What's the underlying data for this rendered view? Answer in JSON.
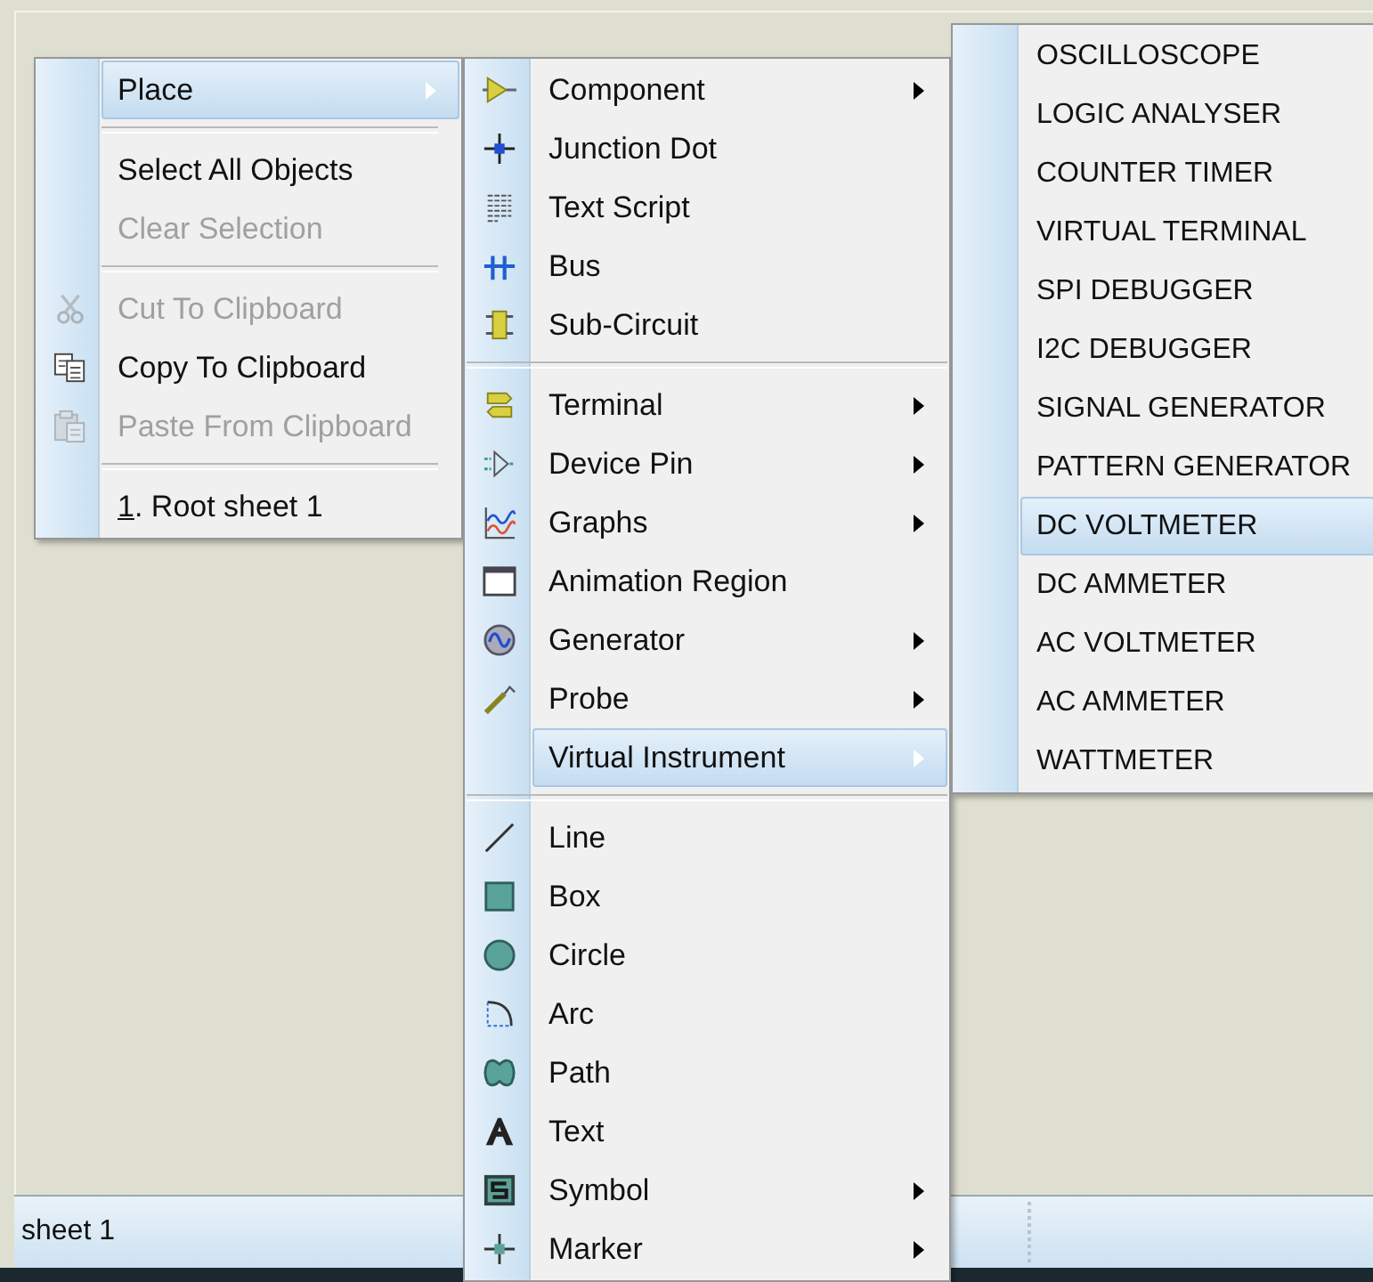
{
  "context_menu": {
    "groups": [
      [
        {
          "label": "Place",
          "disabled": false,
          "selected": true,
          "submenu": true
        }
      ],
      [
        {
          "label": "Select All Objects",
          "disabled": false,
          "selected": false,
          "submenu": false
        },
        {
          "label": "Clear Selection",
          "disabled": true,
          "selected": false,
          "submenu": false
        }
      ],
      [
        {
          "label": "Cut To Clipboard",
          "disabled": true,
          "selected": false,
          "submenu": false
        },
        {
          "label": "Copy To Clipboard",
          "disabled": false,
          "selected": false,
          "submenu": false
        },
        {
          "label": "Paste From Clipboard",
          "disabled": true,
          "selected": false,
          "submenu": false
        }
      ],
      [
        {
          "label": "1. Root sheet 1",
          "disabled": false,
          "selected": false,
          "submenu": false,
          "underline_first": true
        }
      ]
    ]
  },
  "place_menu": {
    "groups": [
      [
        {
          "label": "Component",
          "disabled": false,
          "selected": false,
          "submenu": true
        },
        {
          "label": "Junction Dot",
          "disabled": false,
          "selected": false,
          "submenu": false
        },
        {
          "label": "Text Script",
          "disabled": false,
          "selected": false,
          "submenu": false
        },
        {
          "label": "Bus",
          "disabled": false,
          "selected": false,
          "submenu": false
        },
        {
          "label": "Sub-Circuit",
          "disabled": false,
          "selected": false,
          "submenu": false
        }
      ],
      [
        {
          "label": "Terminal",
          "disabled": false,
          "selected": false,
          "submenu": true
        },
        {
          "label": "Device Pin",
          "disabled": false,
          "selected": false,
          "submenu": true
        },
        {
          "label": "Graphs",
          "disabled": false,
          "selected": false,
          "submenu": true
        },
        {
          "label": "Animation Region",
          "disabled": false,
          "selected": false,
          "submenu": false
        },
        {
          "label": "Generator",
          "disabled": false,
          "selected": false,
          "submenu": true
        },
        {
          "label": "Probe",
          "disabled": false,
          "selected": false,
          "submenu": true
        },
        {
          "label": "Virtual Instrument",
          "disabled": false,
          "selected": true,
          "submenu": true
        }
      ],
      [
        {
          "label": "Line",
          "disabled": false,
          "selected": false,
          "submenu": false
        },
        {
          "label": "Box",
          "disabled": false,
          "selected": false,
          "submenu": false
        },
        {
          "label": "Circle",
          "disabled": false,
          "selected": false,
          "submenu": false
        },
        {
          "label": "Arc",
          "disabled": false,
          "selected": false,
          "submenu": false
        },
        {
          "label": "Path",
          "disabled": false,
          "selected": false,
          "submenu": false
        },
        {
          "label": "Text",
          "disabled": false,
          "selected": false,
          "submenu": false
        },
        {
          "label": "Symbol",
          "disabled": false,
          "selected": false,
          "submenu": true
        },
        {
          "label": "Marker",
          "disabled": false,
          "selected": false,
          "submenu": true
        }
      ]
    ]
  },
  "instrument_menu": {
    "groups": [
      [
        {
          "label": "OSCILLOSCOPE",
          "selected": false
        },
        {
          "label": "LOGIC ANALYSER",
          "selected": false
        },
        {
          "label": "COUNTER TIMER",
          "selected": false
        },
        {
          "label": "VIRTUAL TERMINAL",
          "selected": false
        },
        {
          "label": "SPI DEBUGGER",
          "selected": false
        },
        {
          "label": "I2C DEBUGGER",
          "selected": false
        },
        {
          "label": "SIGNAL GENERATOR",
          "selected": false
        },
        {
          "label": "PATTERN GENERATOR",
          "selected": false
        },
        {
          "label": "DC VOLTMETER",
          "selected": true
        },
        {
          "label": "DC AMMETER",
          "selected": false
        },
        {
          "label": "AC VOLTMETER",
          "selected": false
        },
        {
          "label": "AC AMMETER",
          "selected": false
        },
        {
          "label": "WATTMETER",
          "selected": false
        }
      ]
    ]
  },
  "status_bar": {
    "text": "sheet 1"
  }
}
